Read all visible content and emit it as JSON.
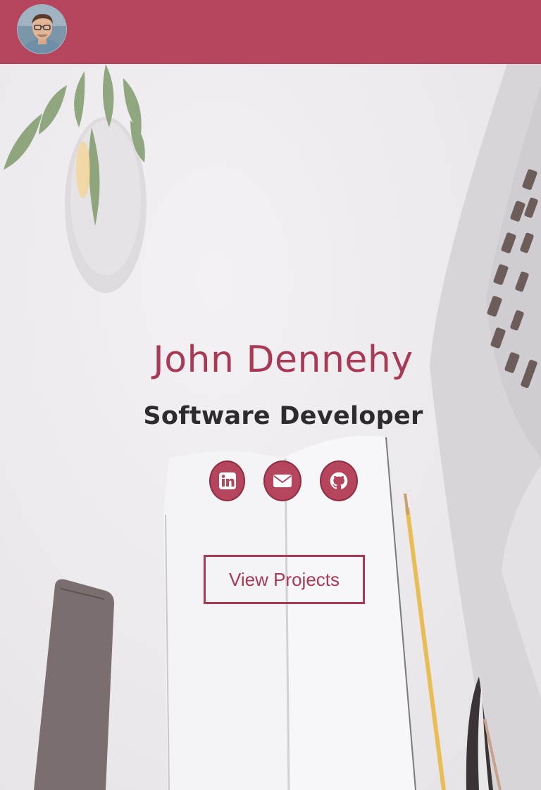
{
  "header": {
    "avatar_icon": "profile-photo",
    "brand_color": "#b4455d"
  },
  "hero": {
    "name": "John Dennehy",
    "title": "Software Developer",
    "social": [
      {
        "icon": "linkedin-icon"
      },
      {
        "icon": "envelope-icon"
      },
      {
        "icon": "github-icon"
      }
    ],
    "cta_label": "View Projects",
    "accent_color": "#a83a55"
  }
}
